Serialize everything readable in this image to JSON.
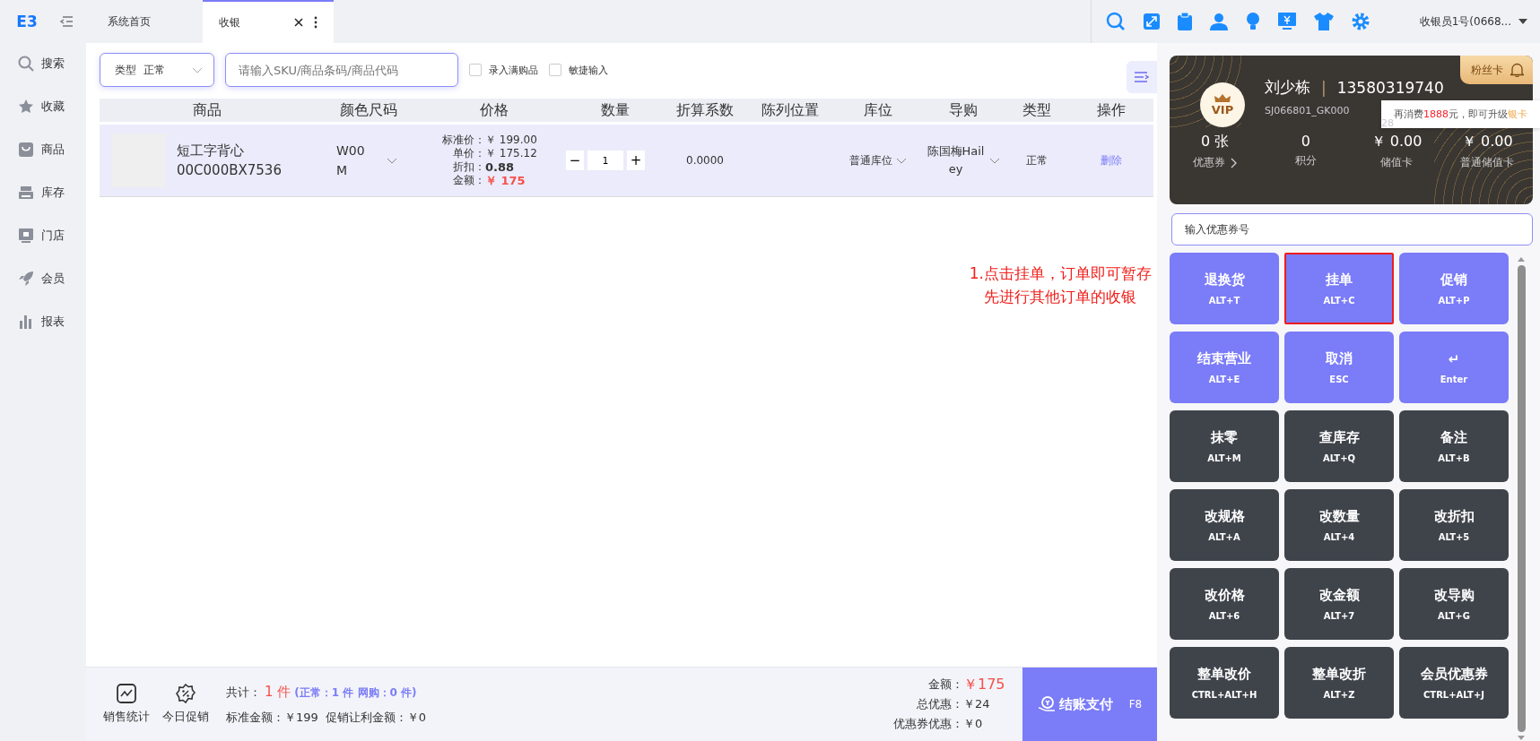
{
  "logo": "E3",
  "tabs": [
    {
      "label": "系统首页",
      "selected": false
    },
    {
      "label": "收银",
      "selected": true
    }
  ],
  "user": "收银员1号(0668...",
  "sidebar": {
    "items": [
      {
        "label": "搜索"
      },
      {
        "label": "收藏"
      },
      {
        "label": "商品"
      },
      {
        "label": "库存"
      },
      {
        "label": "门店"
      },
      {
        "label": "会员"
      },
      {
        "label": "报表"
      }
    ]
  },
  "toolbar": {
    "type_select": {
      "label": "类型",
      "value": "正常"
    },
    "search": {
      "placeholder": "请输入SKU/商品条码/商品代码"
    },
    "checkboxes": [
      {
        "label": "录入满购品",
        "checked": false
      },
      {
        "label": "敏捷输入",
        "checked": false
      }
    ]
  },
  "table": {
    "columns": [
      "商品",
      "颜色尺码",
      "价格",
      "数量",
      "折算系数",
      "陈列位置",
      "库位",
      "导购",
      "类型",
      "操作"
    ],
    "rows": [
      {
        "name": "短工字背心",
        "code": "00C000BX7536",
        "spec": "W00M",
        "prices": [
          {
            "label": "标准价：",
            "value": "￥ 199.00",
            "kind": "plain"
          },
          {
            "label": "单价：",
            "value": "￥ 175.12",
            "kind": "plain"
          },
          {
            "label": "折扣：",
            "value": "0.88",
            "kind": "bold"
          },
          {
            "label": "金额：",
            "value": "￥ 175",
            "kind": "red"
          }
        ],
        "qty": "1",
        "minus": "−",
        "plus": "+",
        "factor": "0.0000",
        "location": "普通库位",
        "guide": "陈国梅Hailey",
        "type": "正常",
        "action": "删除"
      }
    ]
  },
  "annotation": [
    "1.点击挂单，订单即可暂存",
    "先进行其他订单的收银"
  ],
  "member": {
    "badge": "粉丝卡",
    "avatar": "VIP",
    "name": "刘少栋",
    "separator": "|",
    "phone": "13580319740",
    "id": "SJ066801_GK000",
    "id_tail": "28",
    "tooltip": {
      "before": "再消费",
      "amount": "1888",
      "middle": "元，即可升级",
      "level": "银卡"
    },
    "stats": [
      {
        "value": "0 张",
        "label": "优惠券",
        "link": true
      },
      {
        "value": "0",
        "label": "积分",
        "link": false
      },
      {
        "value": "￥ 0.00",
        "label": "储值卡",
        "link": false
      },
      {
        "value": "￥ 0.00",
        "label": "普通储值卡",
        "link": false
      }
    ]
  },
  "coupon": {
    "placeholder": "输入优惠券号"
  },
  "keys": [
    {
      "label": "退换货",
      "shortcut": "ALT+T",
      "kind": "primary",
      "highlighted": false
    },
    {
      "label": "挂单",
      "shortcut": "ALT+C",
      "kind": "primary",
      "highlighted": true
    },
    {
      "label": "促销",
      "shortcut": "ALT+P",
      "kind": "primary",
      "highlighted": false
    },
    {
      "label": "结束营业",
      "shortcut": "ALT+E",
      "kind": "primary",
      "highlighted": false
    },
    {
      "label": "取消",
      "shortcut": "ESC",
      "kind": "primary",
      "highlighted": false
    },
    {
      "label": "↵",
      "shortcut": "Enter",
      "kind": "primary",
      "highlighted": false
    },
    {
      "label": "抹零",
      "shortcut": "ALT+M",
      "kind": "dark",
      "highlighted": false
    },
    {
      "label": "查库存",
      "shortcut": "ALT+Q",
      "kind": "dark",
      "highlighted": false
    },
    {
      "label": "备注",
      "shortcut": "ALT+B",
      "kind": "dark",
      "highlighted": false
    },
    {
      "label": "改规格",
      "shortcut": "ALT+A",
      "kind": "dark",
      "highlighted": false
    },
    {
      "label": "改数量",
      "shortcut": "ALT+4",
      "kind": "dark",
      "highlighted": false
    },
    {
      "label": "改折扣",
      "shortcut": "ALT+5",
      "kind": "dark",
      "highlighted": false
    },
    {
      "label": "改价格",
      "shortcut": "ALT+6",
      "kind": "dark",
      "highlighted": false
    },
    {
      "label": "改金额",
      "shortcut": "ALT+7",
      "kind": "dark",
      "highlighted": false
    },
    {
      "label": "改导购",
      "shortcut": "ALT+G",
      "kind": "dark",
      "highlighted": false
    },
    {
      "label": "整单改价",
      "shortcut": "CTRL+ALT+H",
      "kind": "dark",
      "highlighted": false
    },
    {
      "label": "整单改折",
      "shortcut": "ALT+Z",
      "kind": "dark",
      "highlighted": false
    },
    {
      "label": "会员优惠券",
      "shortcut": "CTRL+ALT+J",
      "kind": "dark",
      "highlighted": false
    }
  ],
  "footer": {
    "tools": [
      {
        "label": "销售统计"
      },
      {
        "label": "今日促销"
      }
    ],
    "total_label": "共计：",
    "total_count": "1 件",
    "total_breakdown": "(正常：1 件  网购：0 件)",
    "standard": "标准金额：￥199",
    "promo": "促销让利金额：￥0",
    "amounts": [
      {
        "label": "金额：",
        "value": "￥175",
        "kind": "red"
      },
      {
        "label": "总优惠：",
        "value": "￥24",
        "kind": "plain"
      },
      {
        "label": "优惠券优惠：",
        "value": "￥0",
        "kind": "plain"
      }
    ],
    "checkout": {
      "label": "结账支付",
      "key": "F8"
    }
  }
}
